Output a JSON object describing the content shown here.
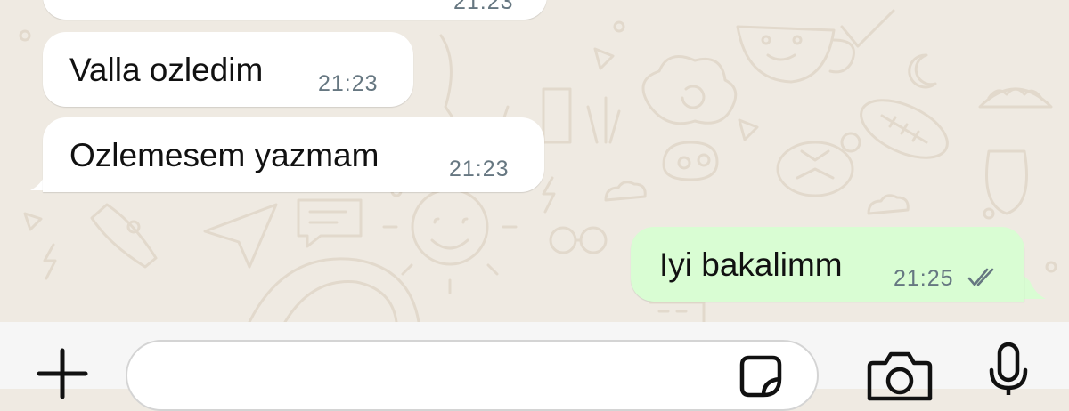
{
  "conversation": {
    "messages": [
      {
        "direction": "incoming",
        "text": "",
        "time": "21:23"
      },
      {
        "direction": "incoming",
        "text": "Valla ozledim",
        "time": "21:23"
      },
      {
        "direction": "incoming",
        "text": "Ozlemesem yazmam",
        "time": "21:23"
      },
      {
        "direction": "outgoing",
        "text": "Iyi bakalimm",
        "time": "21:25",
        "status": "read"
      }
    ]
  },
  "composer": {
    "input_value": "",
    "icons": [
      "plus-icon",
      "sticker-icon",
      "camera-icon",
      "microphone-icon"
    ]
  },
  "colors": {
    "background": "#efeae2",
    "incoming_bubble": "#ffffff",
    "outgoing_bubble": "#d9fdd3",
    "timestamp": "#667781",
    "read_ticks": "#667781"
  }
}
